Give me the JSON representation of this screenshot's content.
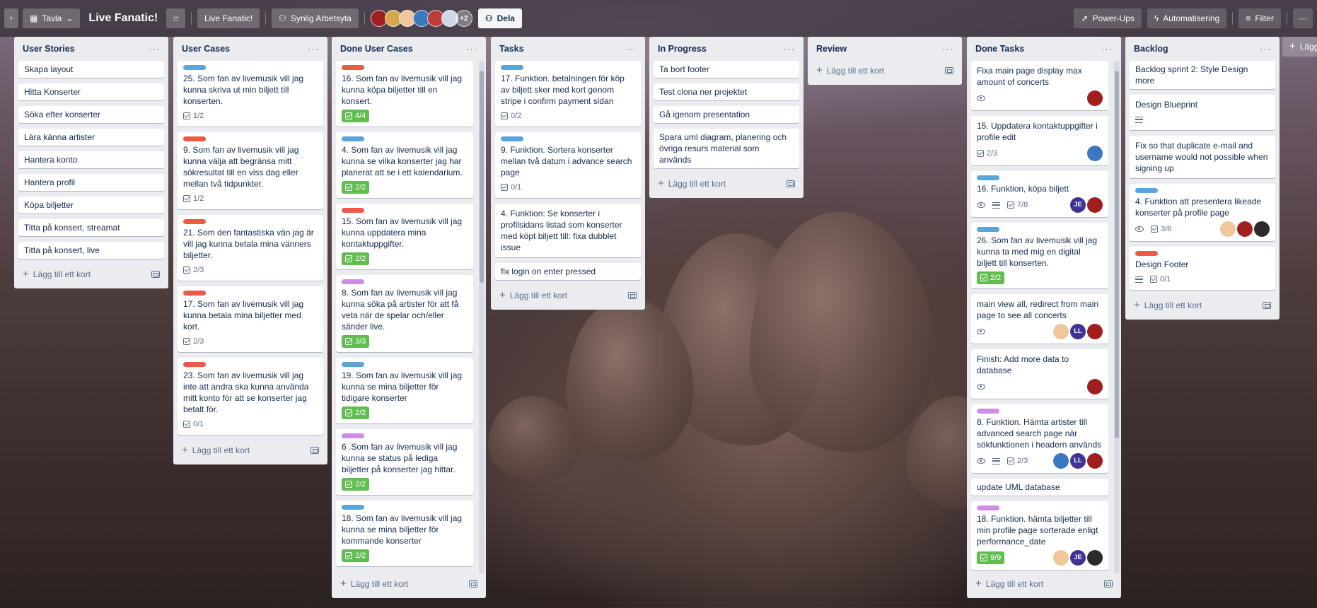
{
  "header": {
    "view_switch": "Tavla",
    "board_title": "Live Fanatic!",
    "workspace": "Live Fanatic!",
    "visibility": "Synlig Arbetsyta",
    "extra_members": "+2",
    "share": "Dela",
    "powerups": "Power-Ups",
    "automation": "Automatisering",
    "filter": "Filter",
    "more": "···"
  },
  "add_card_label": "Lägg till ett kort",
  "add_list_label": "Lägg",
  "colors": {
    "red_label": "#eb5a46",
    "blue_label": "#5aa4d8",
    "purple_label": "#cd8de5",
    "complete_green": "#61bd4f",
    "list_bg": "#ebecf0"
  },
  "lists": [
    {
      "title": "User Stories",
      "cards": [
        {
          "text": "Skapa layout"
        },
        {
          "text": "Hitta Konserter"
        },
        {
          "text": "Söka efter konserter"
        },
        {
          "text": "Lära känna artister"
        },
        {
          "text": "Hantera konto"
        },
        {
          "text": "Hantera profil"
        },
        {
          "text": "Köpa biljetter"
        },
        {
          "text": "Titta på konsert, streamat"
        },
        {
          "text": "Titta på konsert, live"
        }
      ]
    },
    {
      "title": "User Cases",
      "cards": [
        {
          "label": "blue",
          "text": "25. Som fan av livemusik vill jag kunna skriva ut min biljett till konserten.",
          "checklist": "1/2"
        },
        {
          "label": "red",
          "text": "9. Som fan av livemusik vill jag kunna välja att begränsa mitt sökresultat till en viss dag eller mellan två tidpunkter.",
          "checklist": "1/2"
        },
        {
          "label": "red",
          "text": "21. Som den fantastiska vän jag är vill jag kunna betala mina vänners biljetter.",
          "checklist": "2/3"
        },
        {
          "label": "red",
          "text": "17. Som fan av livemusik vill jag kunna betala mina biljetter med kort.",
          "checklist": "2/3"
        },
        {
          "label": "red",
          "text": "23. Som fan av livemusik vill jag inte att andra ska kunna använda mitt konto för att se konserter jag betalt för.",
          "checklist": "0/1"
        }
      ]
    },
    {
      "title": "Done User Cases",
      "cards": [
        {
          "label": "red",
          "text": "16. Som fan av livemusik vill jag kunna köpa biljetter till en konsert.",
          "checklist": "4/4",
          "complete": true
        },
        {
          "label": "blue",
          "text": "4. Som fan av livemusik vill jag kunna se vilka konserter jag har planerat att se i ett kalendarium.",
          "checklist": "2/2",
          "complete": true
        },
        {
          "label": "red",
          "text": "15. Som fan av livemusik vill jag kunna uppdatera mina kontaktuppgifter.",
          "checklist": "2/2",
          "complete": true
        },
        {
          "label": "purple",
          "text": "8. Som fan av livemusik vill jag kunna söka på artister för att få veta när de spelar och/eller sänder live.",
          "checklist": "3/3",
          "complete": true
        },
        {
          "label": "blue",
          "text": "19. Som fan av livemusik vill jag kunna se mina biljetter för tidigare konserter",
          "checklist": "2/2",
          "complete": true
        },
        {
          "label": "purple",
          "text": "6 .Som fan av livemusik vill jag kunna se status på lediga biljetter på konserter jag hittar.",
          "checklist": "2/2",
          "complete": true
        },
        {
          "label": "blue",
          "text": "18. Som fan av livemusik vill jag kunna se mina biljetter för kommande konserter",
          "checklist": "2/2",
          "complete": true
        }
      ]
    },
    {
      "title": "Tasks",
      "cards": [
        {
          "label": "blue",
          "text": "17. Funktion. betalningen för köp av biljett sker med kort genom stripe i confirm payment sidan",
          "checklist": "0/2"
        },
        {
          "label": "blue",
          "text": "9. Funktion. Sortera konserter mellan två datum i advance search page",
          "checklist": "0/1"
        },
        {
          "text": "4. Funktion: Se konserter i profilsidans listad som konserter med köpt biljett till: fixa dubblet issue"
        },
        {
          "text": "fix login on enter pressed"
        }
      ]
    },
    {
      "title": "In Progress",
      "cards": [
        {
          "text": "Ta bort footer"
        },
        {
          "text": "Test clona ner projektet"
        },
        {
          "text": "Gå igenom presentation"
        },
        {
          "text": "Spara uml diagram, planering och övriga resurs material som används"
        }
      ]
    },
    {
      "title": "Review",
      "cards": []
    },
    {
      "title": "Done Tasks",
      "cards": [
        {
          "text": "Fixa main page display max amount of concerts",
          "watch": true,
          "members": [
            "red"
          ]
        },
        {
          "text": "15. Uppdatera kontaktuppgifter i profile edit",
          "checklist": "2/3",
          "members": [
            "blue"
          ]
        },
        {
          "label": "blue",
          "text": "16. Funktion, köpa biljett",
          "watch": true,
          "desc": true,
          "checklist": "7/8",
          "members": [
            "JE",
            "red"
          ]
        },
        {
          "label": "blue",
          "text": "26. Som fan av livemusik vill jag kunna ta med mig en digital biljett till konserten.",
          "checklist": "2/2",
          "complete": true
        },
        {
          "text": "main view all, redirect from main page to see all concerts",
          "watch": true,
          "members": [
            "face",
            "LL",
            "red"
          ]
        },
        {
          "text": "Finish: Add more data to database",
          "watch": true,
          "members": [
            "red"
          ]
        },
        {
          "label": "purple",
          "text": "8. Funktion. Hämta artister till advanced search page när sökfunktionen i headern används",
          "watch": true,
          "desc": true,
          "checklist": "2/3",
          "members": [
            "blue",
            "LL",
            "red"
          ]
        },
        {
          "text": "update UML database"
        },
        {
          "label": "purple",
          "text": "18. Funktion. hämta biljetter till min profile page sorterade enligt performance_date",
          "checklist": "9/9",
          "complete": true,
          "members": [
            "face",
            "JE",
            "homer"
          ]
        }
      ]
    },
    {
      "title": "Backlog",
      "cards": [
        {
          "text": "Backlog sprint 2: Style Design more"
        },
        {
          "text": "Design Blueprint",
          "desc": true
        },
        {
          "text": "Fix so that duplicate e-mail and username would not possible when signing up"
        },
        {
          "label": "blue",
          "text": "4. Funktion att presentera likeade konserter på profile page",
          "watch": true,
          "checklist": "3/6",
          "members": [
            "face",
            "red",
            "homer"
          ]
        },
        {
          "label": "red",
          "text": "Design Footer",
          "desc": true,
          "checklist": "0/1"
        }
      ]
    }
  ]
}
